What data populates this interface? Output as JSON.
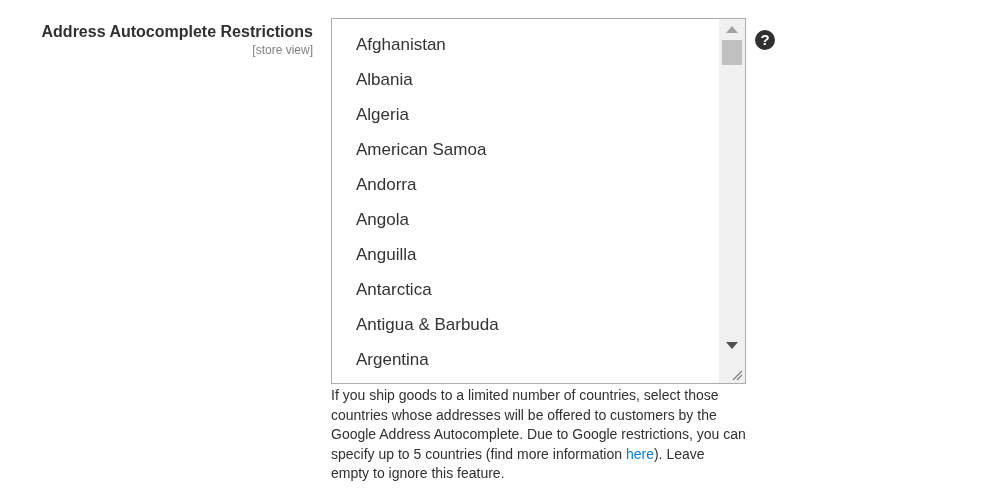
{
  "field": {
    "label": "Address Autocomplete Restrictions",
    "scope": "[store view]",
    "options": [
      {
        "label": "Afghanistan",
        "selected": false
      },
      {
        "label": "Albania",
        "selected": false
      },
      {
        "label": "Algeria",
        "selected": false
      },
      {
        "label": "American Samoa",
        "selected": false
      },
      {
        "label": "Andorra",
        "selected": false
      },
      {
        "label": "Angola",
        "selected": false
      },
      {
        "label": "Anguilla",
        "selected": false
      },
      {
        "label": "Antarctica",
        "selected": false
      },
      {
        "label": "Antigua & Barbuda",
        "selected": false
      },
      {
        "label": "Argentina",
        "selected": false
      }
    ],
    "help_icon": "?",
    "note": {
      "before": "If you ship goods to a limited number of countries, select those countries whose addresses will be offered to customers by the Google Address Autocomplete. Due to Google restrictions, you can specify up to 5 countries (find more information ",
      "link": "here",
      "after": "). Leave empty to ignore this feature."
    }
  }
}
